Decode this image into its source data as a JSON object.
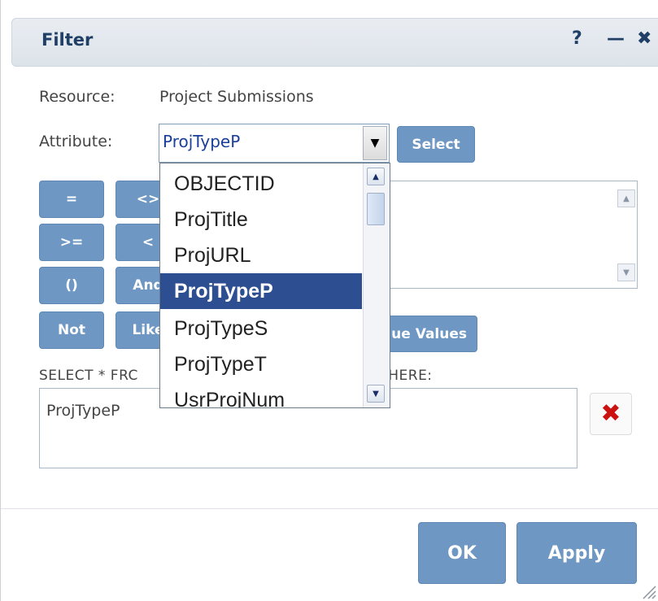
{
  "dialog": {
    "title": "Filter",
    "help": "?",
    "minimize": "—",
    "close": "✖"
  },
  "resource": {
    "label": "Resource:",
    "value": "Project Submissions"
  },
  "attribute": {
    "label": "Attribute:",
    "value": "ProjTypeP",
    "select_label": "Select"
  },
  "operators": [
    {
      "label": "="
    },
    {
      "label": "<>"
    },
    {
      "label": ">="
    },
    {
      "label": "<"
    },
    {
      "label": "()"
    },
    {
      "label": "And"
    },
    {
      "label": "Not"
    },
    {
      "label": "Like"
    }
  ],
  "unique_values_label": "Unique Values",
  "dropdown": {
    "options": [
      "OBJECTID",
      "ProjTitle",
      "ProjURL",
      "ProjTypeP",
      "ProjTypeS",
      "ProjTypeT",
      "UsrProjNum"
    ],
    "selected": "ProjTypeP"
  },
  "sql": {
    "label_left": "SELECT * FRC",
    "label_right": "WHERE:",
    "expression": "ProjTypeP"
  },
  "footer": {
    "ok_label": "OK",
    "apply_label": "Apply"
  },
  "colors": {
    "button": "#6f97c3",
    "title": "#1f3f66",
    "selected_option": "#2e4e92",
    "clear": "#cc1111"
  }
}
